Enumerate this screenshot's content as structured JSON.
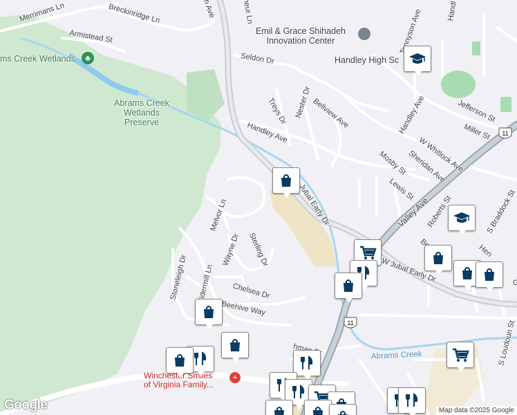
{
  "map": {
    "streets": {
      "merrimans": "Merrimans Ln",
      "breckinridge": "Breckinridge Ln",
      "armistead": "Armistead St",
      "seldon": "Seldon Dr",
      "handley_ave": "Handley Ave",
      "treys": "Treys Dr",
      "nester": "Nester Dr",
      "bellview": "Bellview Ave",
      "bellview2": "Bellview",
      "jubal1": "Jubal Early Dr",
      "jubal2": "W Jubal Early Dr",
      "valley": "Valley Ave",
      "handley_ave2": "Handley Ave",
      "w_whitlock": "W Whitlock Ave",
      "sheridan": "Sheridan Ave",
      "mosby": "Mosby St",
      "lewis": "Lewis St",
      "roberts": "Roberts St",
      "s_braddock": "S Braddock St",
      "jefferson": "Jefferson St",
      "miller": "Miller St",
      "tennyson": "Tennyson Ave",
      "melvor": "Melvor Ln",
      "wayne": "Wayne Dr",
      "sterling": "Sterling Dr",
      "stoneleigh": "Stoneleigh Dr",
      "cidermill": "Cidermill Ln",
      "chelsea": "Chelsea Dr",
      "beehive": "Beehive Way",
      "s_loudoun": "S Loudoun St",
      "ch_ave": "ch Ave",
      "neur": "neur Ln",
      "hen": "Hen",
      "g": "G",
      "hman": "hman Dr",
      "handl": "Handl"
    },
    "pois": {
      "innovation": "Emil & Grace Shihadeh\nInnovation Center",
      "handley_high": "Handley High Sc",
      "wetlands": "ms Creek Wetlands",
      "preserve": "Abrams Creek\nWetlands\nPreserve",
      "abrams_creek": "Abrams Creek",
      "hospital": "Winchester Smiles\nof Virginia Family..."
    },
    "highway_shield": "11",
    "attribution": "Map data ©2025 Google",
    "logo": "Google",
    "pin_icons": [
      "shopping-bag",
      "cart",
      "restaurant",
      "school"
    ],
    "colors": {
      "park": "#cde8cf",
      "water": "#aadaff",
      "road": "#ffffff",
      "highway": "#b4bcc6",
      "commercial": "#f1e6cc",
      "pin": "#0b3b61"
    }
  }
}
